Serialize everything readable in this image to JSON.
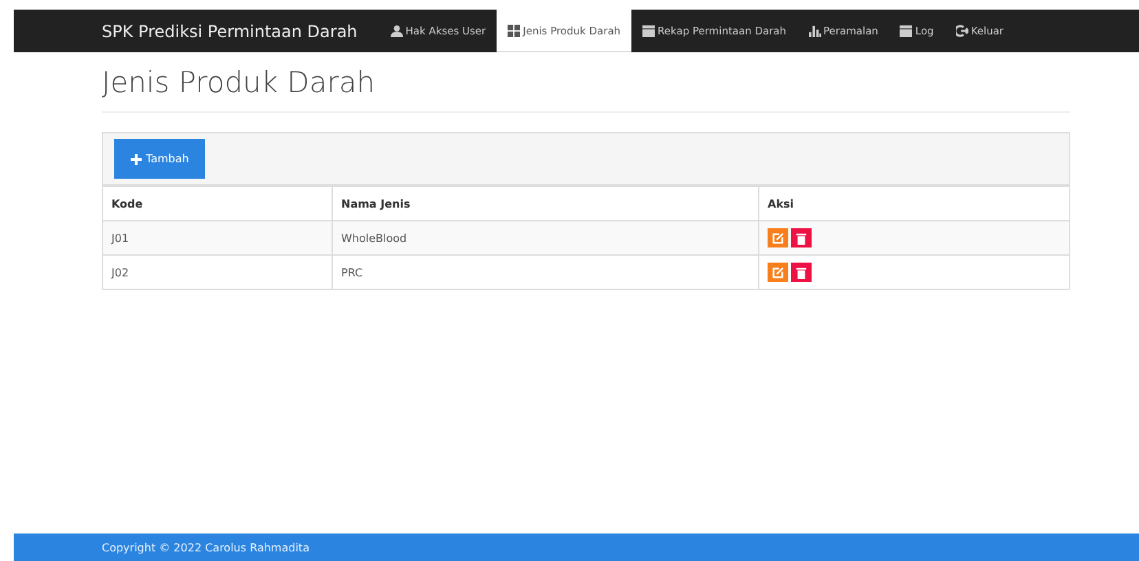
{
  "navbar": {
    "brand": "SPK Prediksi Permintaan Darah",
    "items": [
      {
        "label": "Hak Akses User",
        "kind": "user",
        "selected": false
      },
      {
        "label": "Jenis Produk Darah",
        "kind": "grid",
        "selected": true
      },
      {
        "label": "Rekap Permintaan Darah",
        "kind": "calendar",
        "selected": false
      },
      {
        "label": "Peramalan",
        "kind": "chart",
        "selected": false
      },
      {
        "label": "Log",
        "kind": "calendar",
        "selected": false
      },
      {
        "label": "Keluar",
        "kind": "logout",
        "selected": false
      }
    ]
  },
  "page_title": "Jenis Produk Darah",
  "add_button": "Tambah",
  "table": {
    "columns": [
      "Kode",
      "Nama Jenis",
      "Aksi"
    ],
    "rows": [
      {
        "kode": "J01",
        "nama": "WholeBlood"
      },
      {
        "kode": "J02",
        "nama": "PRC"
      }
    ]
  },
  "footer": "Copyright © 2022 Carolus Rahmadita"
}
